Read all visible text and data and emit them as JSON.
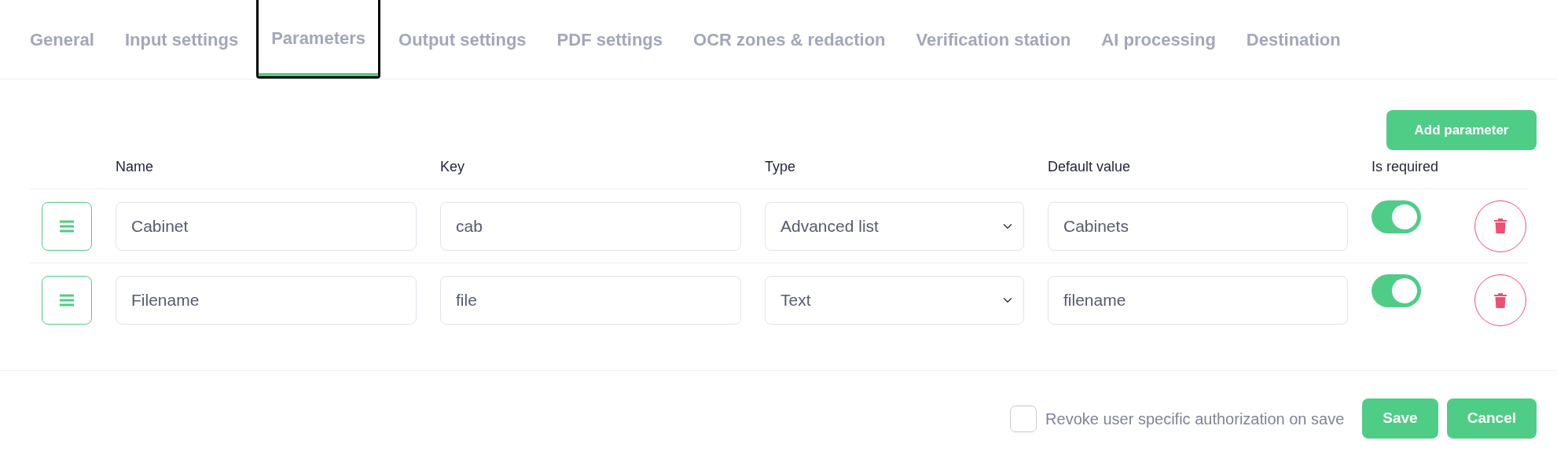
{
  "tabs": [
    {
      "label": "General",
      "selected": false
    },
    {
      "label": "Input settings",
      "selected": false
    },
    {
      "label": "Parameters",
      "selected": true
    },
    {
      "label": "Output settings",
      "selected": false
    },
    {
      "label": "PDF settings",
      "selected": false
    },
    {
      "label": "OCR zones & redaction",
      "selected": false
    },
    {
      "label": "Verification station",
      "selected": false
    },
    {
      "label": "AI processing",
      "selected": false
    },
    {
      "label": "Destination",
      "selected": false
    }
  ],
  "add_button": "Add parameter",
  "columns": [
    "Name",
    "Key",
    "Type",
    "Default value",
    "Is required"
  ],
  "rows": [
    {
      "name": "Cabinet",
      "key": "cab",
      "type": "Advanced list",
      "default_value": "Cabinets",
      "required": true
    },
    {
      "name": "Filename",
      "key": "file",
      "type": "Text",
      "default_value": "filename",
      "required": true
    }
  ],
  "revoke": {
    "label": "Revoke user specific authorization on save",
    "checked": false
  },
  "buttons": [
    "Save",
    "Cancel"
  ]
}
